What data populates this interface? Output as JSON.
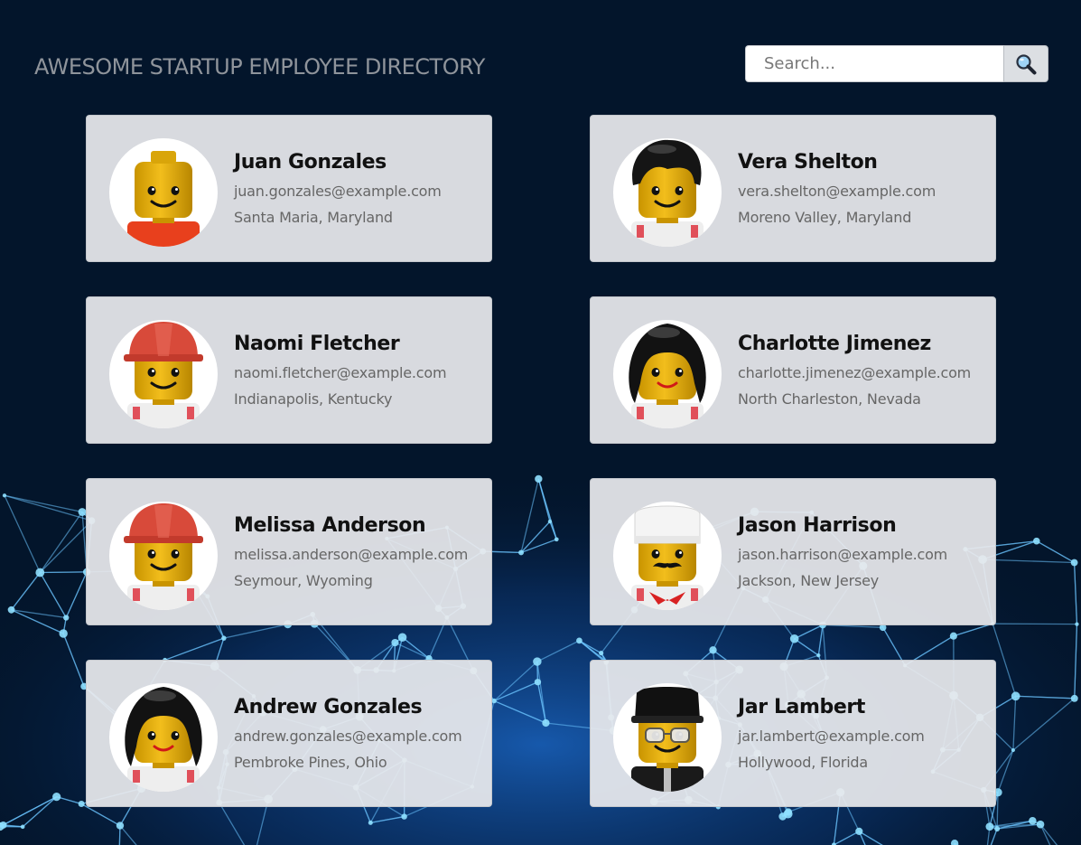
{
  "header": {
    "title": "AWESOME STARTUP EMPLOYEE DIRECTORY",
    "search_placeholder": "Search...",
    "search_button_icon": "search-icon"
  },
  "employees": [
    {
      "name": "Juan Gonzales",
      "email": "juan.gonzales@example.com",
      "location": "Santa Maria, Maryland",
      "avatar": {
        "hair": "none",
        "torso": "#e8401d",
        "mouth": "smile"
      }
    },
    {
      "name": "Vera Shelton",
      "email": "vera.shelton@example.com",
      "location": "Moreno Valley, Maryland",
      "avatar": {
        "hair": "black-swept",
        "torso": "#eeeeee",
        "mouth": "smile"
      }
    },
    {
      "name": "Naomi Fletcher",
      "email": "naomi.fletcher@example.com",
      "location": "Indianapolis, Kentucky",
      "avatar": {
        "hair": "red-hardhat",
        "torso": "#eeeeee",
        "mouth": "smile"
      }
    },
    {
      "name": "Charlotte Jimenez",
      "email": "charlotte.jimenez@example.com",
      "location": "North Charleston, Nevada",
      "avatar": {
        "hair": "black-long",
        "torso": "#eeeeee",
        "mouth": "red-smile"
      }
    },
    {
      "name": "Melissa Anderson",
      "email": "melissa.anderson@example.com",
      "location": "Seymour, Wyoming",
      "avatar": {
        "hair": "red-hardhat",
        "torso": "#eeeeee",
        "mouth": "smile"
      }
    },
    {
      "name": "Jason Harrison",
      "email": "jason.harrison@example.com",
      "location": "Jackson, New Jersey",
      "avatar": {
        "hair": "chef-hat",
        "torso": "#eeeeee",
        "mouth": "mustache"
      }
    },
    {
      "name": "Andrew Gonzales",
      "email": "andrew.gonzales@example.com",
      "location": "Pembroke Pines, Ohio",
      "avatar": {
        "hair": "black-long",
        "torso": "#eeeeee",
        "mouth": "red-smile"
      }
    },
    {
      "name": "Jar Lambert",
      "email": "jar.lambert@example.com",
      "location": "Hollywood, Florida",
      "avatar": {
        "hair": "black-cap",
        "torso": "#1a1a1a",
        "mouth": "smile",
        "glasses": true
      }
    }
  ]
}
